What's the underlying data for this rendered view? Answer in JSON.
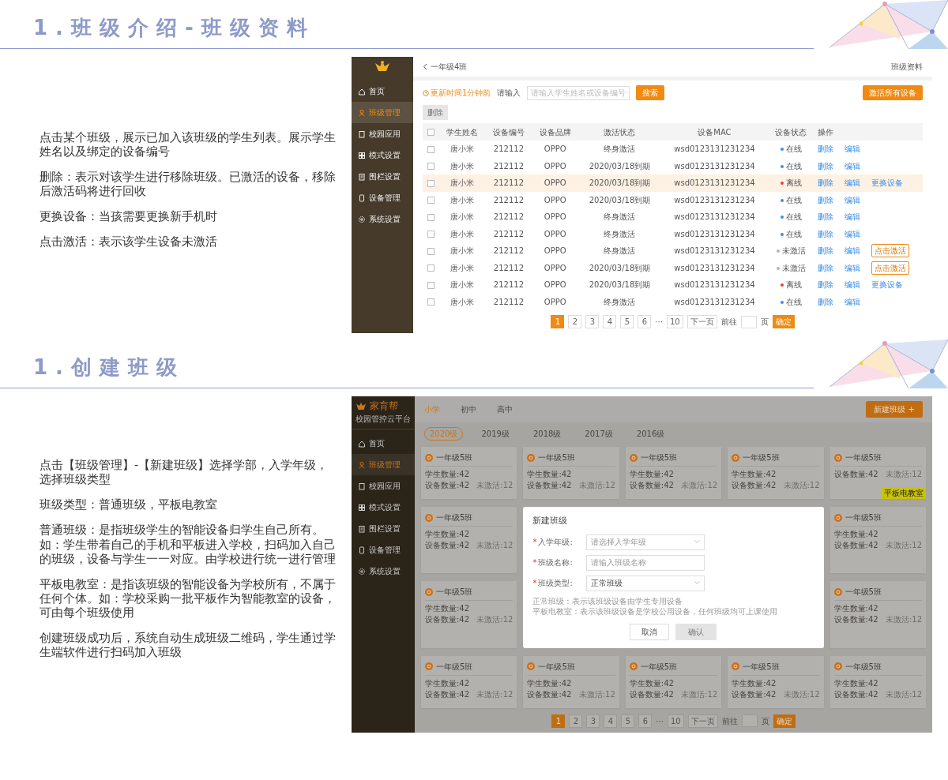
{
  "sections": [
    {
      "heading": "1.班级介绍-班级资料",
      "paragraphs": [
        "点击某个班级，展示已加入该班级的学生列表。展示学生姓名以及绑定的设备编号",
        "删除：表示对该学生进行移除班级。已激活的设备，移除后激活码将进行回收",
        "更换设备：当孩需要更换新手机时",
        "点击激活：表示该学生设备未激活"
      ]
    },
    {
      "heading": "1.创建班级",
      "paragraphs": [
        "点击【班级管理】-【新建班级】选择学部，入学年级，选择班级类型",
        "班级类型：普通班级，平板电教室",
        "普通班级：是指班级学生的智能设备归学生自己所有。如：学生带着自己的手机和平板进入学校，扫码加入自己的班级，设备与学生一一对应。由学校进行统一进行管理",
        "平板电教室：是指该班级的智能设备为学校所有，不属于任何个体。如：学校采购一批平板作为智能教室的设备，可由每个班级使用",
        "创建班级成功后，系统自动生成班级二维码，学生通过学生端软件进行扫码加入班级"
      ]
    }
  ],
  "class_screen": {
    "sidebar": [
      {
        "label": "首页",
        "selected": false
      },
      {
        "label": "班级管理",
        "selected": true
      },
      {
        "label": "校园应用",
        "selected": false
      },
      {
        "label": "模式设置",
        "selected": false
      },
      {
        "label": "围栏设置",
        "selected": false
      },
      {
        "label": "设备管理",
        "selected": false
      },
      {
        "label": "系统设置",
        "selected": false
      }
    ],
    "title": "一年级4班",
    "profile_link": "班级资料",
    "update_time": "更新时间1分钟前",
    "search_label": "请输入",
    "search_placeholder": "请输入学生姓名或设备编号",
    "search_button": "搜索",
    "activate_all_button": "激活所有设备",
    "delete_button": "删除",
    "select_all_checked": false,
    "columns": [
      "学生姓名",
      "设备编号",
      "设备品牌",
      "激活状态",
      "设备MAC",
      "设备状态",
      "操作"
    ],
    "rows": [
      {
        "checked": false,
        "selected": false,
        "name": "唐小米",
        "number": "212112",
        "brand": "OPPO",
        "activation": "终身激活",
        "mac": "wsd0123131231234",
        "status": {
          "label": "在线",
          "color": "#3b8eea"
        },
        "actions": [
          "删除",
          "编辑"
        ]
      },
      {
        "checked": false,
        "selected": false,
        "name": "唐小米",
        "number": "212112",
        "brand": "OPPO",
        "activation": "2020/03/18到期",
        "mac": "wsd0123131231234",
        "status": {
          "label": "在线",
          "color": "#3b8eea"
        },
        "actions": [
          "删除",
          "编辑"
        ]
      },
      {
        "checked": false,
        "selected": true,
        "name": "唐小米",
        "number": "212112",
        "brand": "OPPO",
        "activation": "2020/03/18到期",
        "mac": "wsd0123131231234",
        "status": {
          "label": "离线",
          "color": "#e8413c"
        },
        "actions": [
          "删除",
          "编辑"
        ],
        "extra": {
          "kind": "link",
          "label": "更换设备"
        }
      },
      {
        "checked": false,
        "selected": false,
        "name": "唐小米",
        "number": "212112",
        "brand": "OPPO",
        "activation": "2020/03/18到期",
        "mac": "wsd0123131231234",
        "status": {
          "label": "在线",
          "color": "#3b8eea"
        },
        "actions": [
          "删除",
          "编辑"
        ]
      },
      {
        "checked": false,
        "selected": false,
        "name": "唐小米",
        "number": "212112",
        "brand": "OPPO",
        "activation": "终身激活",
        "mac": "wsd0123131231234",
        "status": {
          "label": "在线",
          "color": "#3b8eea"
        },
        "actions": [
          "删除",
          "编辑"
        ]
      },
      {
        "checked": false,
        "selected": false,
        "name": "唐小米",
        "number": "212112",
        "brand": "OPPO",
        "activation": "终身激活",
        "mac": "wsd0123131231234",
        "status": {
          "label": "在线",
          "color": "#3b8eea"
        },
        "actions": [
          "删除",
          "编辑"
        ]
      },
      {
        "checked": false,
        "selected": false,
        "name": "唐小米",
        "number": "212112",
        "brand": "OPPO",
        "activation": "终身激活",
        "mac": "wsd0123131231234",
        "status": {
          "label": "未激活",
          "color": "#b5b5b5"
        },
        "actions": [
          "删除",
          "编辑"
        ],
        "extra": {
          "kind": "button",
          "label": "点击激活"
        }
      },
      {
        "checked": false,
        "selected": false,
        "name": "唐小米",
        "number": "212112",
        "brand": "OPPO",
        "activation": "2020/03/18到期",
        "mac": "wsd0123131231234",
        "status": {
          "label": "未激活",
          "color": "#b5b5b5"
        },
        "actions": [
          "删除",
          "编辑"
        ],
        "extra": {
          "kind": "button",
          "label": "点击激活"
        }
      },
      {
        "checked": false,
        "selected": false,
        "name": "唐小米",
        "number": "212112",
        "brand": "OPPO",
        "activation": "2020/03/18到期",
        "mac": "wsd0123131231234",
        "status": {
          "label": "离线",
          "color": "#e8413c"
        },
        "actions": [
          "删除",
          "编辑"
        ],
        "extra": {
          "kind": "link",
          "label": "更换设备"
        }
      },
      {
        "checked": false,
        "selected": false,
        "name": "唐小米",
        "number": "212112",
        "brand": "OPPO",
        "activation": "终身激活",
        "mac": "wsd0123131231234",
        "status": {
          "label": "在线",
          "color": "#3b8eea"
        },
        "actions": [
          "删除",
          "编辑"
        ]
      }
    ],
    "pagination": {
      "pages": [
        {
          "label": "1",
          "selected": true
        },
        {
          "label": "2",
          "selected": false
        },
        {
          "label": "3",
          "selected": false
        },
        {
          "label": "4",
          "selected": false
        },
        {
          "label": "5",
          "selected": false
        },
        {
          "label": "6",
          "selected": false
        }
      ],
      "ellipsis": "···",
      "last": "10",
      "next": "下一页",
      "goto_prefix": "前往",
      "goto_suffix": "页",
      "confirm": "确定"
    }
  },
  "create_screen": {
    "brand": "家育帮",
    "subtitle": "校园管控云平台",
    "sidebar": [
      {
        "label": "首页",
        "selected": false
      },
      {
        "label": "班级管理",
        "selected": true
      },
      {
        "label": "校园应用",
        "selected": false
      },
      {
        "label": "模式设置",
        "selected": false
      },
      {
        "label": "围栏设置",
        "selected": false
      },
      {
        "label": "设备管理",
        "selected": false
      },
      {
        "label": "系统设置",
        "selected": false
      }
    ],
    "stages": [
      {
        "label": "小学",
        "selected": true
      },
      {
        "label": "初中",
        "selected": false
      },
      {
        "label": "高中",
        "selected": false
      }
    ],
    "new_class_button": "新建班级 +",
    "years": [
      {
        "label": "2020级",
        "selected": true
      },
      {
        "label": "2019级",
        "selected": false
      },
      {
        "label": "2018级",
        "selected": false
      },
      {
        "label": "2017级",
        "selected": false
      },
      {
        "label": "2016级",
        "selected": false
      }
    ],
    "cards": [
      {
        "title": "一年级5班",
        "students": "学生数量:42",
        "devices": "设备数量:42",
        "inactive": "未激活:12"
      },
      {
        "title": "一年级5班",
        "students": "学生数量:42",
        "devices": "设备数量:42",
        "inactive": "未激活:12"
      },
      {
        "title": "一年级5班",
        "students": "学生数量:42",
        "devices": "设备数量:42",
        "inactive": "未激活:12"
      },
      {
        "title": "一年级5班",
        "students": "学生数量:42",
        "devices": "设备数量:42",
        "inactive": "未激活:12"
      },
      {
        "title": "一年级5班",
        "devices": "设备数量:42",
        "inactive": "未激活:12",
        "tag": "平板电教室"
      },
      {
        "title": "一年级5班",
        "students": "学生数量:42",
        "devices": "设备数量:42",
        "inactive": "未激活:12"
      },
      {
        "title": "一年级5班",
        "students": "学生数量:42",
        "devices": "设备数量:42",
        "inactive": "未激活:12"
      },
      {
        "title": "一年级5班",
        "students": "学生数量:42",
        "devices": "设备数量:42",
        "inactive": "未激活:12"
      },
      {
        "title": "一年级5班",
        "students": "学生数量:42",
        "devices": "设备数量:42",
        "inactive": "未激活:12"
      },
      {
        "title": "一年级5班",
        "students": "学生数量:42",
        "devices": "设备数量:42",
        "inactive": "未激活:12"
      },
      {
        "title": "一年级5班",
        "students": "学生数量:42",
        "devices": "设备数量:42",
        "inactive": "未激活:12"
      },
      {
        "title": "一年级5班",
        "students": "学生数量:42",
        "devices": "设备数量:42",
        "inactive": "未激活:12"
      },
      {
        "title": "一年级5班",
        "students": "学生数量:42",
        "devices": "设备数量:42",
        "inactive": "未激活:12"
      },
      {
        "title": "一年级5班",
        "students": "学生数量:42",
        "devices": "设备数量:42",
        "inactive": "未激活:12"
      }
    ],
    "dialog": {
      "title": "新建班级",
      "fields": [
        {
          "marker": "*",
          "label": "入学年级:",
          "kind": "select",
          "placeholder": "请选择入学年级"
        },
        {
          "marker": "*",
          "label": "班级名称:",
          "kind": "input",
          "placeholder": "请输入班级名称"
        },
        {
          "marker": "*",
          "label": "班级类型:",
          "kind": "select",
          "value": "正常班级"
        }
      ],
      "notes": [
        "正常班级：表示该班级设备由学生专用设备",
        "平板电教室：表示该班级设备是学校公用设备，任何班级均可上课使用"
      ],
      "cancel": "取消",
      "confirm": "确认",
      "confirm_disabled": true
    },
    "pagination": {
      "pages": [
        {
          "label": "1",
          "selected": true
        },
        {
          "label": "2",
          "selected": false
        },
        {
          "label": "3",
          "selected": false
        },
        {
          "label": "4",
          "selected": false
        },
        {
          "label": "5",
          "selected": false
        },
        {
          "label": "6",
          "selected": false
        }
      ],
      "ellipsis": "···",
      "last": "10",
      "next": "下一页",
      "goto_prefix": "前往",
      "goto_suffix": "页",
      "confirm": "确定"
    }
  }
}
